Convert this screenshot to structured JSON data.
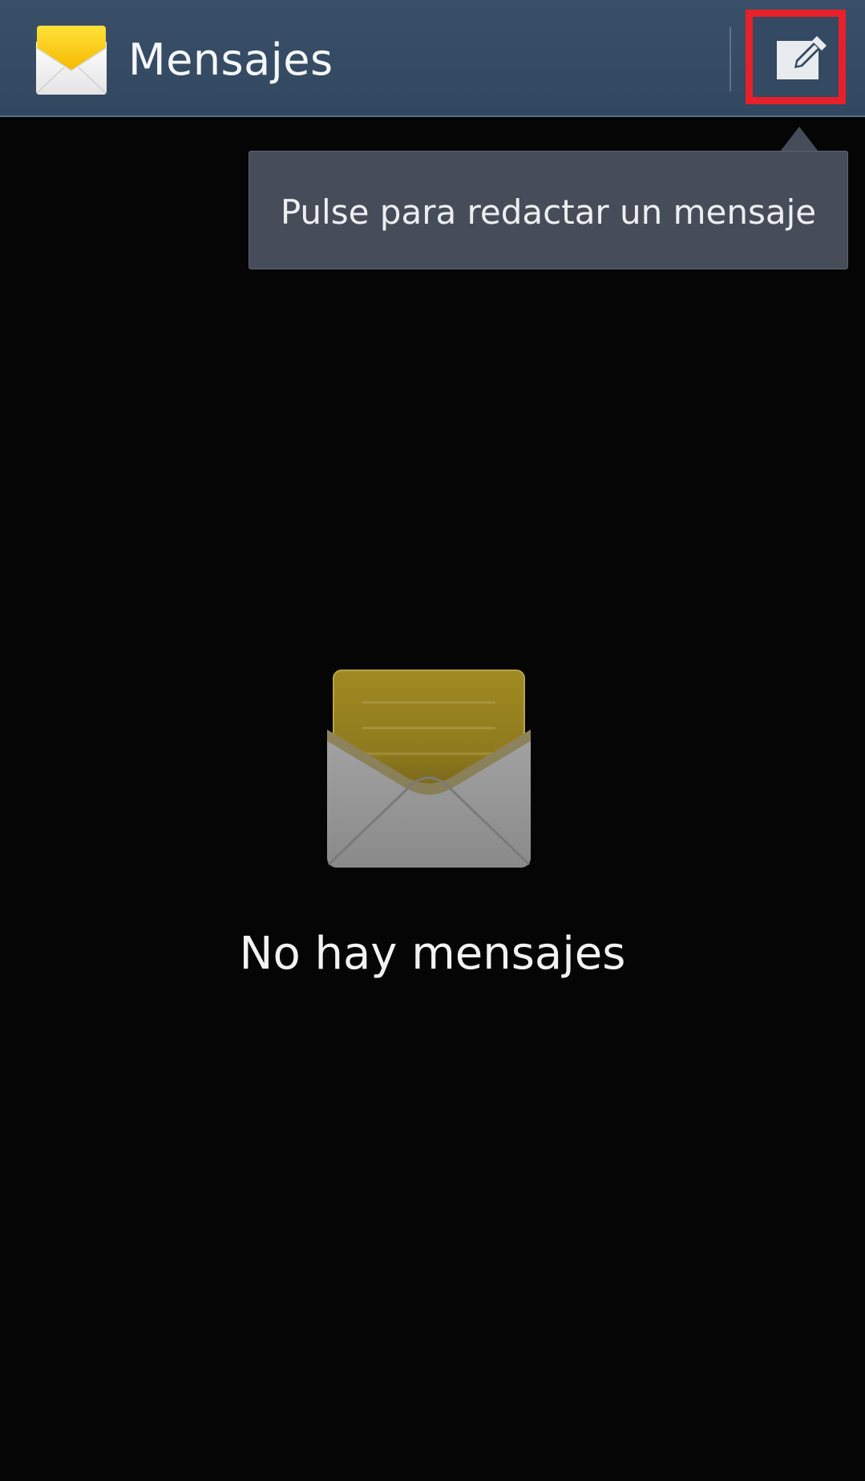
{
  "action_bar": {
    "title": "Mensajes",
    "app_icon": "envelope-yellow-icon",
    "compose_icon": "compose-pencil-icon",
    "bar_color": "#344a62",
    "highlight_color": "#e8202a"
  },
  "tooltip": {
    "text": "Pulse para redactar un mensaje"
  },
  "empty_state": {
    "icon": "open-envelope-icon",
    "message": "No hay mensajes"
  }
}
